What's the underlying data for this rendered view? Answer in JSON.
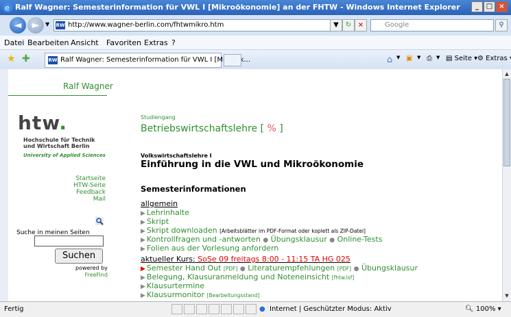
{
  "window": {
    "title": "Ralf Wagner: Semesterinformation für VWL I [Mikroökonomie] an der FHTW - Windows Internet Explorer"
  },
  "address_bar": {
    "url": "http://www.wagner-berlin.com/fhtwmikro.htm",
    "search_placeholder": "Google"
  },
  "menu": [
    "Datei",
    "Bearbeiten",
    "Ansicht",
    "Favoriten",
    "Extras",
    "?"
  ],
  "tab": {
    "title": "Ralf Wagner: Semesterinformation für VWL I [Mikroök..."
  },
  "command_bar": {
    "page": "Seite",
    "extras": "Extras"
  },
  "sidebar": {
    "site_name": "Ralf Wagner",
    "logo_text": "htw",
    "logo_name_1": "Hochschule für Technik",
    "logo_name_2": "und Wirtschaft Berlin",
    "logo_subtitle": "University of Applied Sciences",
    "links": [
      "Startseite",
      "HTW-Seite",
      "Feedback",
      "Mail"
    ],
    "search_label": "Suche in meinen Seiten",
    "search_button": "Suchen",
    "powered_by": "powered by",
    "freefind": "FreeFind"
  },
  "main": {
    "studiengang_label": "Studiengang",
    "studiengang": "Betriebswirtschaftslehre",
    "bracket_open": "[",
    "bracket_symbol": "%",
    "bracket_close": "]",
    "course_category": "Volkswirtschaftslehre I",
    "course_title": "Einführung in die VWL und Mikroökonomie",
    "section_heading": "Semesterinformationen",
    "allgemein": "allgemein",
    "lehrinhalte": "Lehrinhalte",
    "skript": "Skript",
    "skript_download": "Skript downloaden",
    "skript_download_note": "[Arbeitsblätter im PDF-Format oder koplett als ZIP-Datei]",
    "kontrollfragen": "Kontrollfragen und -antworten",
    "uebungsklausur": "Übungsklausur",
    "online_tests": "Online-Tests",
    "folien": "Folien aus der Vorlesung anfordern",
    "aktueller_kurs": "aktueller Kurs:",
    "kurs_info": "SoSe 09 freitags 8:00 - 11:15 TA HG 025",
    "hand_out": "Semester Hand Out",
    "pdf": "[PDF]",
    "literatur": "Literaturempfehlungen",
    "uebungsklausur2": "Übungsklausur",
    "belegung": "Belegung, Klausuranmeldung und Noteneinsicht",
    "belegung_note": "[fhtw.lsf]",
    "klausurtermine": "Klausurtermine",
    "klausurmonitor": "Klausurmonitor",
    "klausurmonitor_note": "[Bearbeitungsstand]"
  },
  "status": {
    "left": "Fertig",
    "zone": "Internet | Geschützter Modus: Aktiv",
    "zoom": "100%"
  }
}
